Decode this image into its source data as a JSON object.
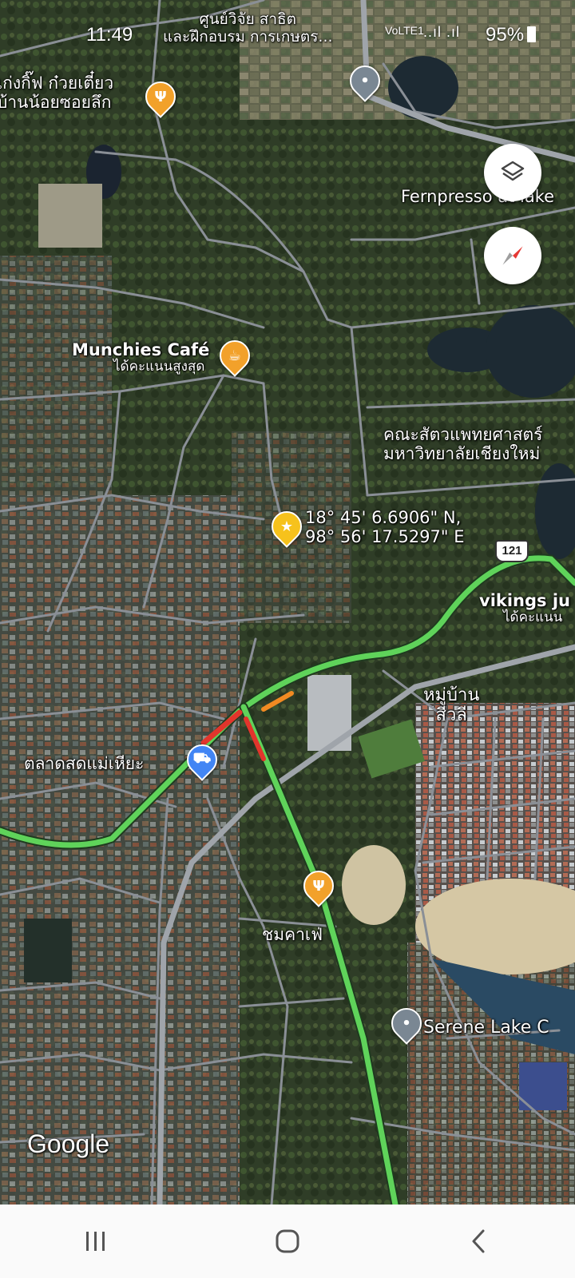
{
  "status_bar": {
    "time": "11:49",
    "network": "VoLTE1",
    "signal": "..ıl .ıl",
    "battery": "95%"
  },
  "map": {
    "places": {
      "research_center_line1": "ศูนย์วิจัย สาธิต",
      "research_center_line2": "และฝึกอบรม การเกษตร...",
      "noodle_shop_line1": "เก่งกิ๊ฟ ก๋วยเตี๋ยว",
      "noodle_shop_line2": "บ้านน้อยซอยลึก",
      "fernpresso": "Fernpresso at lake",
      "munchies": "Munchies Café",
      "munchies_sub": "ได้คะแนนสูงสุด",
      "vet_faculty_line1": "คณะสัตวแพทยศาสตร์",
      "vet_faculty_line2": "มหาวิทยาลัยเชียงใหม่",
      "dropped_pin_lat": "18° 45' 6.6906\" N,",
      "dropped_pin_lon": "98° 56' 17.5297\" E",
      "vikings": "vikings ju",
      "vikings_sub": "ได้คะแนน",
      "village_line1": "หมู่บ้าน",
      "village_line2": "สีวลี",
      "market": "ตลาดสดแม่เหียะ",
      "chom_cafe": "ชมคาเฟ่",
      "serene_lake": "Serene Lake C"
    },
    "route_shield": "121",
    "logo": "Google"
  },
  "icons": {
    "layers_button": "layers-icon",
    "compass_button": "compass-icon",
    "nav_recent": "recent-apps-icon",
    "nav_home": "home-icon",
    "nav_back": "back-icon"
  },
  "colors": {
    "traffic_green": "#5fd35a",
    "traffic_red": "#e2352c",
    "traffic_orange": "#f18a22",
    "road": "#8a8f96",
    "pin_orange": "#f2a12a",
    "pin_blue": "#4285f4",
    "pin_yellow": "#f6c21c"
  }
}
